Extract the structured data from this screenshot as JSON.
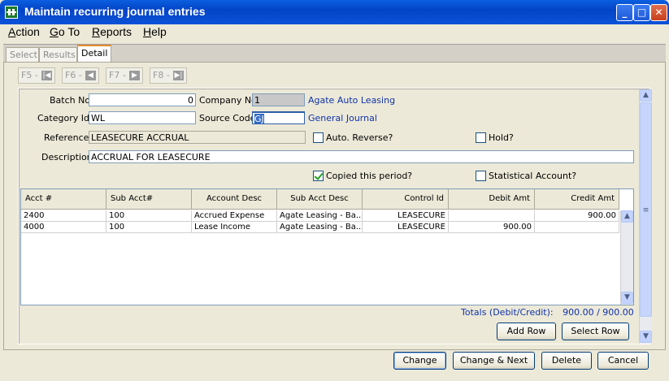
{
  "window": {
    "title": "Maintain recurring journal entries",
    "minimize": "_",
    "maximize": "□",
    "close": "✕"
  },
  "menu": [
    "Action",
    "Go To",
    "Reports",
    "Help"
  ],
  "tabs": [
    "Select",
    "Results",
    "Detail"
  ],
  "nav": [
    {
      "label": "F5 -",
      "icon": "first-record-icon",
      "glyph": "|◀"
    },
    {
      "label": "F6 -",
      "icon": "prev-record-icon",
      "glyph": "◀"
    },
    {
      "label": "F7 -",
      "icon": "next-record-icon",
      "glyph": "▶"
    },
    {
      "label": "F8 -",
      "icon": "last-record-icon",
      "glyph": "▶|"
    }
  ],
  "form": {
    "batch_no_label": "Batch No",
    "batch_no": "0",
    "company_no_label": "Company No",
    "company_no": "1",
    "company_name": "Agate Auto Leasing",
    "category_id_label": "Category Id",
    "category_id": "WL",
    "source_code_label": "Source Code",
    "source_code": "GJ",
    "source_name": "General Journal",
    "reference_label": "Reference",
    "reference": "LEASECURE ACCRUAL",
    "auto_reverse_label": "Auto. Reverse?",
    "auto_reverse": false,
    "hold_label": "Hold?",
    "hold": false,
    "description_label": "Description",
    "description": "ACCRUAL FOR LEASECURE",
    "copied_label": "Copied this period?",
    "copied": true,
    "statistical_label": "Statistical Account?",
    "statistical": false
  },
  "grid": {
    "headers": [
      "Acct #",
      "Sub Acct#",
      "Account Desc",
      "Sub Acct Desc",
      "Control Id",
      "Debit Amt",
      "Credit Amt"
    ],
    "rows": [
      [
        "2400",
        "100",
        "Accrued Expense",
        "Agate  Leasing - Ba...",
        "LEASECURE",
        "",
        "900.00"
      ],
      [
        "4000",
        "100",
        "Lease Income",
        "Agate  Leasing - Ba...",
        "LEASECURE",
        "900.00",
        ""
      ]
    ]
  },
  "totals_label": "Totals (Debit/Credit):",
  "totals_value": "900.00 / 900.00",
  "buttons": {
    "add_row": "Add Row",
    "select_row": "Select Row",
    "change": "Change",
    "change_next": "Change & Next",
    "delete": "Delete",
    "cancel": "Cancel"
  }
}
